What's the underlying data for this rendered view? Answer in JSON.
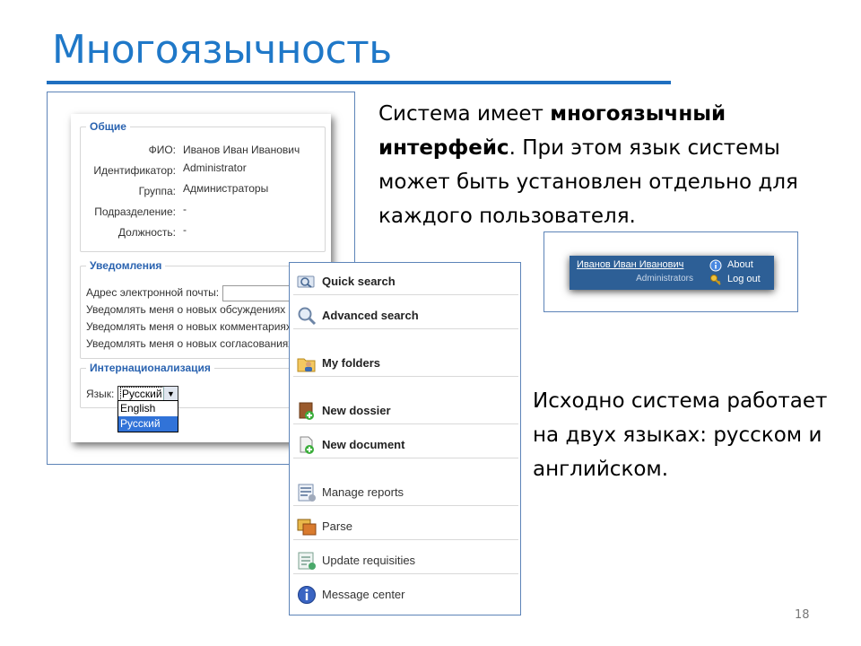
{
  "slide": {
    "title": "Многоязычность",
    "page_number": "18",
    "para1_normal": "Система имеет ",
    "para1_bold": "многоязычный интерфейс",
    "para1_rest": ". При этом язык системы может быть установлен отдельно для каждого пользователя.",
    "para2": "Исходно система работает на двух языках: русском и английском."
  },
  "profile": {
    "general_legend": "Общие",
    "fields": [
      {
        "label": "ФИО:",
        "value": "Иванов Иван Иванович"
      },
      {
        "label": "Идентификатор:",
        "value": "Administrator"
      },
      {
        "label": "Группа:",
        "value": "Администраторы"
      },
      {
        "label": "Подразделение:",
        "value": "-"
      },
      {
        "label": "Должность:",
        "value": "-"
      }
    ],
    "notifications_legend": "Уведомления",
    "email_label": "Адрес электронной почты:",
    "notify_options": [
      "Уведомлять меня о новых обсуждениях",
      "Уведомлять меня о новых комментариях",
      "Уведомлять меня о новых согласованиях"
    ],
    "i18n_legend": "Интернационализация",
    "language_label": "Язык:",
    "language_selected": "Русский",
    "language_options": [
      "English",
      "Русский"
    ]
  },
  "menu": {
    "items": [
      {
        "label": "Quick search",
        "icon": "magnifier-icon"
      },
      {
        "label": "Advanced search",
        "icon": "advanced-search-icon"
      },
      {
        "label": "My folders",
        "icon": "folder-user-icon"
      },
      {
        "label": "New dossier",
        "icon": "dossier-add-icon"
      },
      {
        "label": "New document",
        "icon": "document-add-icon"
      },
      {
        "label": "Manage reports",
        "icon": "reports-icon"
      },
      {
        "label": "Parse",
        "icon": "parse-icon"
      },
      {
        "label": "Update requisities",
        "icon": "update-icon"
      },
      {
        "label": "Message center",
        "icon": "info-icon"
      }
    ]
  },
  "header": {
    "user_name": "Иванов Иван Иванович",
    "role": "Administrators",
    "about_label": "About",
    "logout_label": "Log out",
    "bar_color": "#2d5f96"
  },
  "colors": {
    "title": "#1f78c8",
    "accent": "#2a63b0"
  }
}
